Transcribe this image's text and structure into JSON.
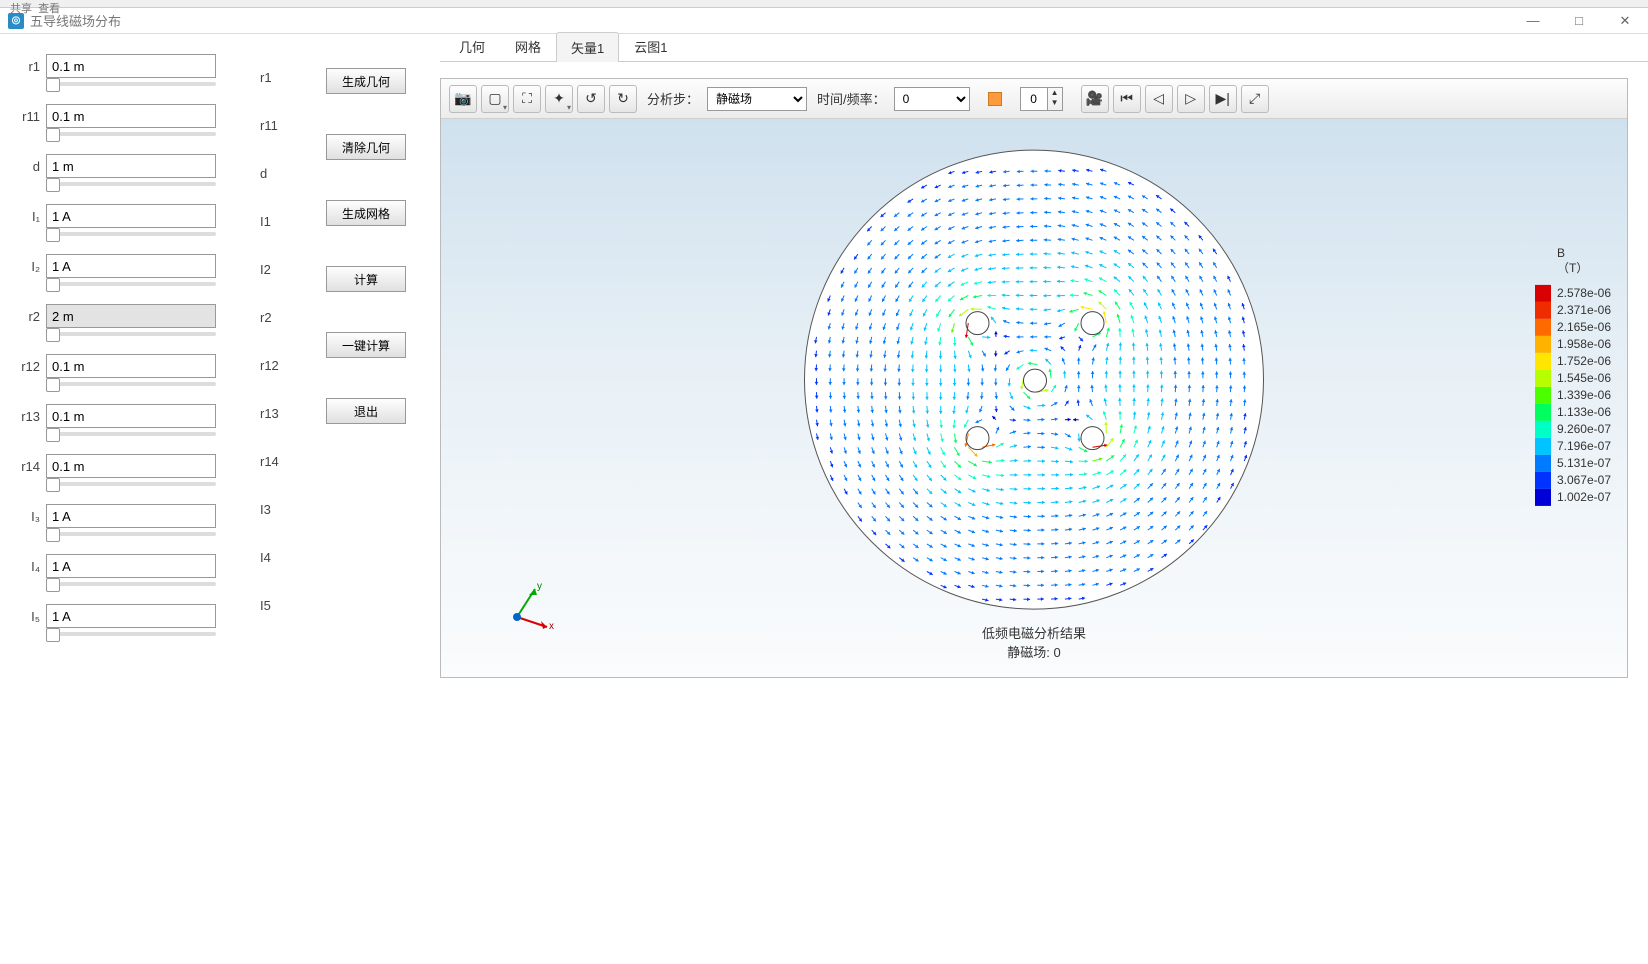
{
  "window": {
    "title": "五导线磁场分布",
    "minimize": "—",
    "maximize": "□",
    "close": "✕"
  },
  "top_menu": {
    "share": "共享",
    "view": "查看"
  },
  "params": [
    {
      "key": "r1",
      "value": "0.1 m"
    },
    {
      "key": "r11",
      "value": "0.1 m"
    },
    {
      "key": "d",
      "value": "1 m"
    },
    {
      "key": "I1",
      "label": "I₁",
      "value": "1 A"
    },
    {
      "key": "I2",
      "label": "I₂",
      "value": "1 A"
    },
    {
      "key": "r2",
      "value": "2 m",
      "gray": true
    },
    {
      "key": "r12",
      "value": "0.1 m"
    },
    {
      "key": "r13",
      "value": "0.1 m"
    },
    {
      "key": "r14",
      "value": "0.1 m"
    },
    {
      "key": "I3",
      "label": "I₃",
      "value": "1 A"
    },
    {
      "key": "I4",
      "label": "I₄",
      "value": "1 A"
    },
    {
      "key": "I5",
      "label": "I₅",
      "value": "1 A"
    }
  ],
  "g_labels": [
    "r1",
    "r11",
    "d",
    "I1",
    "I2",
    "r2",
    "r12",
    "r13",
    "r14",
    "I3",
    "I4",
    "I5"
  ],
  "actions": {
    "gen_geom": "生成几何",
    "clr_geom": "清除几何",
    "gen_mesh": "生成网格",
    "compute": "计算",
    "one_click": "一键计算",
    "exit": "退出"
  },
  "tabs": [
    {
      "id": "geom",
      "label": "几何"
    },
    {
      "id": "mesh",
      "label": "网格"
    },
    {
      "id": "vec1",
      "label": "矢量1",
      "active": true
    },
    {
      "id": "cloud1",
      "label": "云图1"
    }
  ],
  "viz_toolbar": {
    "step_label": "分析步：",
    "step_value": "静磁场",
    "time_label": "时间/频率：",
    "time_value": "0",
    "spin_value": "0"
  },
  "plot": {
    "title_line1": "低频电磁分析结果",
    "title_line2": "静磁场: 0",
    "triad": {
      "x": "x",
      "y": "y"
    }
  },
  "legend": {
    "qty": "B",
    "unit": "（T）",
    "items": [
      {
        "c": "#d80000",
        "v": "2.578e-06"
      },
      {
        "c": "#ee2c00",
        "v": "2.371e-06"
      },
      {
        "c": "#ff6a00",
        "v": "2.165e-06"
      },
      {
        "c": "#ffb200",
        "v": "1.958e-06"
      },
      {
        "c": "#ffe600",
        "v": "1.752e-06"
      },
      {
        "c": "#b7ff00",
        "v": "1.545e-06"
      },
      {
        "c": "#4cff00",
        "v": "1.339e-06"
      },
      {
        "c": "#00ff5e",
        "v": "1.133e-06"
      },
      {
        "c": "#00ffc4",
        "v": "9.260e-07"
      },
      {
        "c": "#00c4ff",
        "v": "7.196e-07"
      },
      {
        "c": "#007bff",
        "v": "5.131e-07"
      },
      {
        "c": "#0033ff",
        "v": "3.067e-07"
      },
      {
        "c": "#0000d6",
        "v": "1.002e-07"
      }
    ]
  },
  "chart_data": {
    "type": "vector_field",
    "quantity": "B",
    "unit": "T",
    "legend_min": 1.002e-07,
    "legend_max": 2.578e-06,
    "domain": {
      "shape": "circle",
      "center": [
        0,
        0
      ],
      "r2": 2.0
    },
    "wires": [
      {
        "name": "center",
        "x": 0,
        "y": 0,
        "r": 0.1,
        "I": 1
      },
      {
        "name": "top-left",
        "x": -0.5,
        "y": 0.5,
        "r": 0.1,
        "I": 1
      },
      {
        "name": "top-right",
        "x": 0.5,
        "y": 0.5,
        "r": 0.1,
        "I": 1
      },
      {
        "name": "bot-left",
        "x": -0.5,
        "y": -0.5,
        "r": 0.1,
        "I": 1
      },
      {
        "name": "bot-right",
        "x": 0.5,
        "y": -0.5,
        "r": 0.1,
        "I": 1
      }
    ],
    "analysis_step": "静磁场",
    "time_frequency": 0,
    "title": "低频电磁分析结果",
    "subtitle": "静磁场: 0",
    "legend_ticks": [
      2.578e-06,
      2.371e-06,
      2.165e-06,
      1.958e-06,
      1.752e-06,
      1.545e-06,
      1.339e-06,
      1.133e-06,
      9.26e-07,
      7.196e-07,
      5.131e-07,
      3.067e-07,
      1.002e-07
    ]
  }
}
